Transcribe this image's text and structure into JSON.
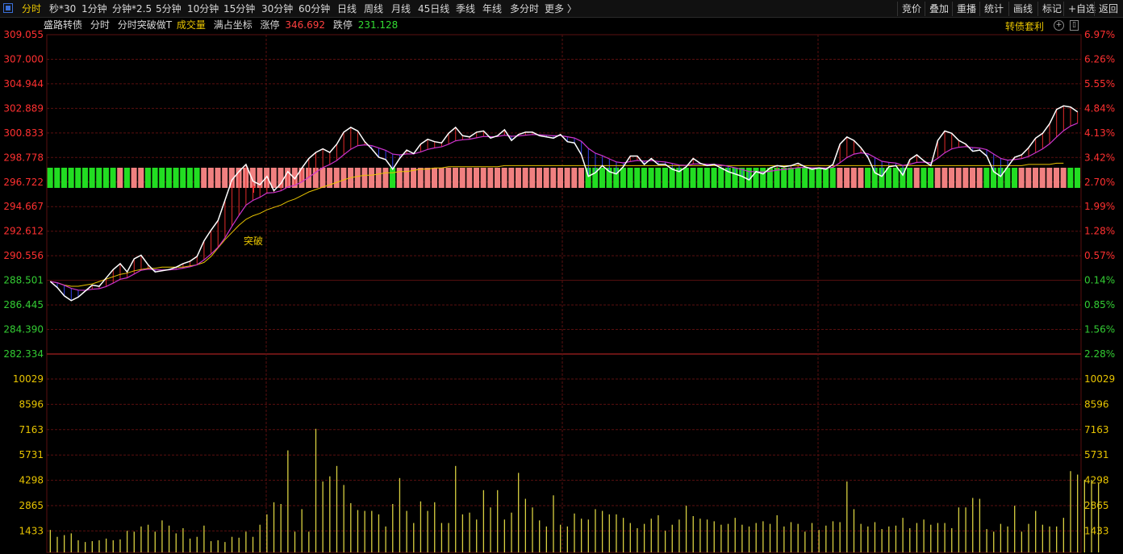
{
  "tabs": [
    "分时",
    "秒*30",
    "1分钟",
    "分钟*2.5",
    "5分钟",
    "10分钟",
    "15分钟",
    "30分钟",
    "60分钟",
    "日线",
    "周线",
    "月线",
    "45日线",
    "季线",
    "年线",
    "多分时",
    "更多 〉"
  ],
  "right_buttons": [
    "竞价",
    "叠加",
    "重播",
    "统计",
    "画线",
    "标记",
    "+自选",
    "返回"
  ],
  "info": {
    "name": "盛路转债",
    "mode1": "分时",
    "mode2": "分时突破做T",
    "volume_label": "成交量",
    "coord_label": "满占坐标",
    "limit_up_label": "涨停",
    "limit_up": "346.692",
    "limit_down_label": "跌停",
    "limit_down": "231.128"
  },
  "arbitrage_label": "转债套利",
  "annotation": "突破",
  "colors": {
    "up": "#e83030",
    "down": "#33cc33",
    "price": "#ffffff",
    "avg": "#e8c400",
    "ma": "#cc33cc",
    "grid": "#5a0f0f",
    "vol": "#d8d040"
  },
  "chart_data": {
    "type": "line",
    "price_axis": [
      "309.055",
      "307.000",
      "304.944",
      "302.889",
      "300.833",
      "298.778",
      "296.722",
      "294.667",
      "292.612",
      "290.556",
      "288.501",
      "286.445",
      "284.390",
      "282.334"
    ],
    "pct_axis": [
      "6.97%",
      "6.26%",
      "5.55%",
      "4.84%",
      "4.13%",
      "3.42%",
      "2.70%",
      "1.99%",
      "1.28%",
      "0.57%",
      "0.14%",
      "0.85%",
      "1.56%",
      "2.28%"
    ],
    "volume_axis": [
      "10029",
      "8596",
      "7163",
      "5731",
      "4298",
      "2865",
      "1433"
    ],
    "price_ylim": [
      282.334,
      309.055
    ],
    "volume_ylim": [
      0,
      10029
    ],
    "price": [
      288.4,
      287.9,
      287.2,
      286.8,
      287.1,
      287.6,
      288.1,
      288.0,
      288.7,
      289.4,
      289.9,
      289.2,
      290.3,
      290.6,
      289.8,
      289.2,
      289.3,
      289.4,
      289.6,
      289.9,
      290.1,
      290.5,
      291.8,
      292.7,
      293.5,
      295.2,
      296.9,
      297.6,
      298.2,
      296.8,
      296.5,
      297.2,
      296.0,
      296.6,
      297.6,
      297.0,
      297.9,
      298.7,
      299.2,
      299.5,
      299.2,
      299.9,
      300.9,
      301.3,
      301.0,
      300.1,
      299.5,
      298.8,
      298.6,
      297.8,
      298.7,
      299.4,
      299.1,
      299.9,
      300.3,
      300.1,
      300.0,
      300.8,
      301.3,
      300.6,
      300.5,
      300.9,
      301.0,
      300.4,
      300.6,
      301.1,
      300.2,
      300.7,
      300.9,
      300.9,
      300.6,
      300.5,
      300.4,
      300.7,
      300.1,
      300.0,
      299.0,
      297.2,
      297.5,
      298.1,
      297.6,
      297.4,
      298.0,
      298.9,
      298.9,
      298.2,
      298.7,
      298.2,
      298.2,
      297.8,
      297.6,
      298.0,
      298.7,
      298.3,
      298.1,
      298.2,
      297.9,
      297.6,
      297.4,
      297.2,
      296.9,
      297.6,
      297.4,
      297.9,
      298.1,
      298.0,
      298.1,
      298.3,
      298.0,
      297.8,
      297.9,
      297.8,
      298.2,
      299.9,
      300.5,
      300.2,
      299.6,
      298.8,
      297.5,
      297.2,
      298.0,
      298.1,
      297.3,
      298.6,
      299.0,
      298.5,
      298.1,
      300.2,
      301.0,
      300.8,
      300.2,
      299.9,
      299.3,
      299.4,
      298.9,
      297.6,
      297.2,
      298.0,
      298.8,
      299.0,
      299.6,
      300.4,
      300.8,
      301.6,
      302.8,
      303.1,
      303.0,
      302.6
    ],
    "avg_price": [
      288.4,
      288.3,
      288.1,
      288.0,
      288.0,
      288.1,
      288.2,
      288.4,
      288.6,
      288.8,
      289.0,
      289.1,
      289.3,
      289.4,
      289.5,
      289.5,
      289.6,
      289.6,
      289.6,
      289.6,
      289.7,
      289.8,
      290.0,
      290.5,
      291.2,
      291.9,
      292.5,
      293.1,
      293.6,
      293.9,
      294.1,
      294.4,
      294.6,
      294.8,
      295.1,
      295.3,
      295.6,
      295.9,
      296.1,
      296.3,
      296.5,
      296.7,
      296.9,
      297.1,
      297.2,
      297.3,
      297.3,
      297.4,
      297.5,
      297.5,
      297.6,
      297.6,
      297.7,
      297.8,
      297.8,
      297.9,
      297.9,
      298.0,
      298.0,
      298.0,
      298.0,
      298.0,
      298.0,
      298.0,
      298.0,
      298.1,
      298.1,
      298.1,
      298.1,
      298.1,
      298.1,
      298.1,
      298.1,
      298.1,
      298.1,
      298.1,
      298.1,
      298.1,
      298.1,
      298.1,
      298.1,
      298.1,
      298.1,
      298.1,
      298.1,
      298.1,
      298.1,
      298.1,
      298.1,
      298.1,
      298.1,
      298.1,
      298.1,
      298.1,
      298.1,
      298.1,
      298.1,
      298.1,
      298.1,
      298.1,
      298.1,
      298.1,
      298.1,
      298.1,
      298.1,
      298.1,
      298.1,
      298.1,
      298.1,
      298.1,
      298.1,
      298.1,
      298.1,
      298.1,
      298.1,
      298.1,
      298.1,
      298.1,
      298.1,
      298.1,
      298.1,
      298.1,
      298.1,
      298.1,
      298.1,
      298.1,
      298.1,
      298.1,
      298.1,
      298.1,
      298.1,
      298.1,
      298.1,
      298.1,
      298.1,
      298.1,
      298.1,
      298.1,
      298.1,
      298.1,
      298.2,
      298.2,
      298.2,
      298.2,
      298.3,
      298.3
    ],
    "volume": [
      1300,
      900,
      1000,
      1100,
      700,
      600,
      650,
      700,
      800,
      700,
      750,
      1250,
      1200,
      1500,
      1600,
      1200,
      1850,
      1550,
      1100,
      1400,
      800,
      900,
      1550,
      650,
      700,
      600,
      900,
      850,
      1200,
      900,
      1600,
      2200,
      2900,
      2800,
      5900,
      1200,
      2500,
      1200,
      7150,
      4100,
      4400,
      5000,
      3900,
      2850,
      2450,
      2400,
      2400,
      2200,
      1500,
      2800,
      4300,
      2400,
      1700,
      2950,
      2400,
      2900,
      1700,
      1700,
      5000,
      2200,
      2300,
      1900,
      3600,
      2600,
      3600,
      1900,
      2300,
      4600,
      3100,
      2600,
      1850,
      1500,
      3300,
      1600,
      1500,
      2250,
      1950,
      1900,
      2500,
      2400,
      2200,
      2200,
      2000,
      1700,
      1400,
      1650,
      1950,
      2150,
      1250,
      1600,
      1900,
      2700,
      2100,
      1950,
      1900,
      1800,
      1600,
      1650,
      2000,
      1600,
      1500,
      1700,
      1800,
      1650,
      2150,
      1500,
      1750,
      1650,
      1200,
      1700,
      1300,
      1550,
      1800,
      1750,
      4100,
      2500,
      1650,
      1500,
      1750,
      1350,
      1500,
      1550,
      2000,
      1400,
      1700,
      1900,
      1600,
      1700,
      1700,
      1400,
      2600,
      2600,
      3150,
      3100,
      1350,
      1200,
      1650,
      1500,
      2700,
      1200,
      1650,
      2400,
      1600,
      1500,
      1500,
      2000,
      4700,
      4500,
      4200,
      4200,
      4000
    ],
    "title": "",
    "xlabel": "",
    "ylabel": ""
  }
}
